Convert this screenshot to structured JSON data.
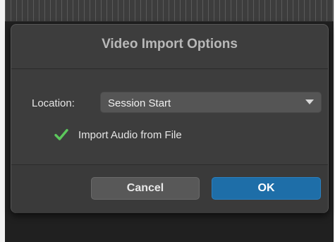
{
  "dialog": {
    "title": "Video Import Options",
    "location": {
      "label": "Location:",
      "selected": "Session Start"
    },
    "import_audio": {
      "label": "Import Audio from File",
      "checked": true
    },
    "buttons": {
      "cancel_label": "Cancel",
      "ok_label": "OK"
    }
  },
  "colors": {
    "accent": "#1e6ea8",
    "checkmark": "#5cc85c"
  }
}
